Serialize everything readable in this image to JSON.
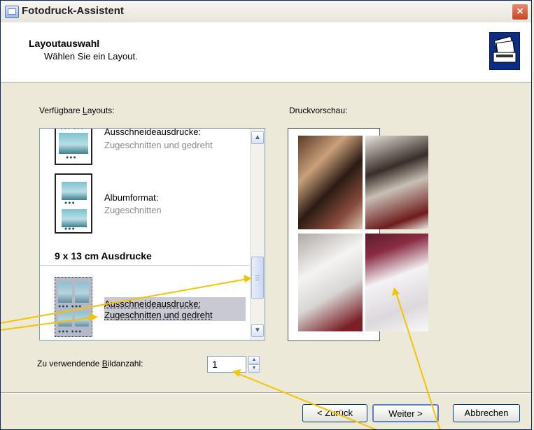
{
  "window": {
    "title": "Fotodruck-Assistent",
    "close_label": "×"
  },
  "header": {
    "title": "Layoutauswahl",
    "subtitle": "Wählen Sie ein Layout."
  },
  "layouts_label_pre": "Verfügbare ",
  "layouts_label_accel": "L",
  "layouts_label_post": "ayouts:",
  "preview_label": "Druckvorschau:",
  "layouts": [
    {
      "title": "Ausschneideausdrucke:",
      "subtitle": "Zugeschnitten und gedreht"
    },
    {
      "title": "Albumformat:",
      "subtitle": "Zugeschnitten"
    }
  ],
  "group_header": "9 x 13 cm Ausdrucke",
  "selected_layout": {
    "title": "Ausschneideausdrucke:",
    "subtitle": "Zugeschnitten und gedreht"
  },
  "count_label_pre": "Zu verwendende ",
  "count_label_accel": "B",
  "count_label_post": "ildanzahl:",
  "count_value": "1",
  "buttons": {
    "back": "< Zurück",
    "next": "Weiter >",
    "cancel": "Abbrechen"
  },
  "colors": {
    "arrow": "#f5c400",
    "accent_blue": "#0b2d83"
  }
}
